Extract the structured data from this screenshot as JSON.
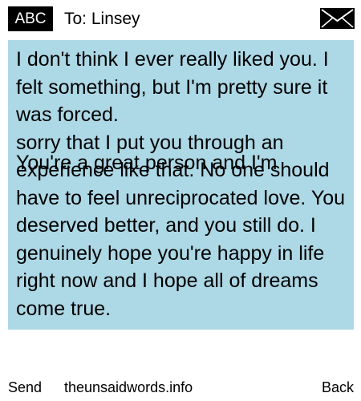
{
  "header": {
    "badge_label": "ABC",
    "recipient_line": "To: Linsey",
    "envelope_icon": "envelope-icon"
  },
  "message": {
    "text_part_1": "I don't think I ever really liked you. I felt something, but I'm pretty sure it was forced.\nsorry that I put you through an experience like that. No one should have to feel unreciprocated love. You deserved better, and you still do. I genuinely hope you're happy in life right now and I hope all of dreams come true.",
    "text_part_2": "You're a great person and I'm",
    "background_color": "#add8e6"
  },
  "footer": {
    "send_label": "Send",
    "site_label": "theunsaidwords.info",
    "back_label": "Back"
  }
}
